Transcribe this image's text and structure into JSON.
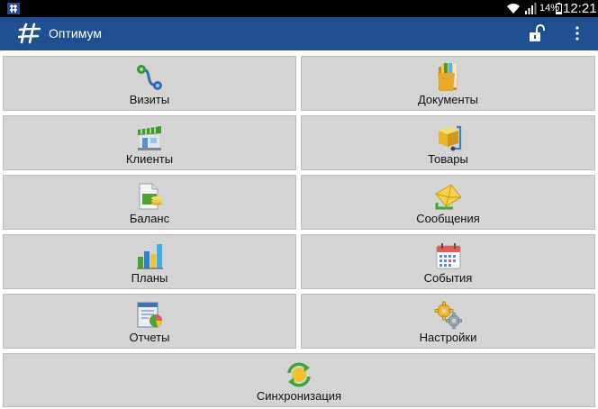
{
  "status_bar": {
    "battery": "14%",
    "time": "12:21"
  },
  "app": {
    "title": "Оптимум"
  },
  "menu": {
    "visits": "Визиты",
    "documents": "Документы",
    "clients": "Клиенты",
    "goods": "Товары",
    "balance": "Баланс",
    "messages": "Сообщения",
    "plans": "Планы",
    "events": "События",
    "reports": "Отчеты",
    "settings": "Настройки",
    "sync": "Синхронизация"
  },
  "colors": {
    "action_bar": "#1d4f91",
    "tile": "#d4d4d4",
    "status_bar": "#000000"
  }
}
